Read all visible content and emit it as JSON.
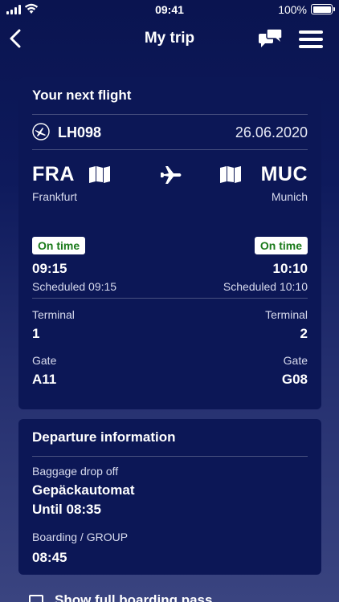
{
  "status_bar": {
    "time": "09:41",
    "battery": "100%"
  },
  "nav": {
    "title": "My trip"
  },
  "next_flight": {
    "title": "Your next flight",
    "flight_number": "LH098",
    "date": "26.06.2020",
    "origin": {
      "code": "FRA",
      "city": "Frankfurt",
      "status": "On time",
      "time": "09:15",
      "scheduled": "Scheduled 09:15",
      "terminal_label": "Terminal",
      "terminal": "1",
      "gate_label": "Gate",
      "gate": "A11"
    },
    "destination": {
      "code": "MUC",
      "city": "Munich",
      "status": "On time",
      "time": "10:10",
      "scheduled": "Scheduled 10:10",
      "terminal_label": "Terminal",
      "terminal": "2",
      "gate_label": "Gate",
      "gate": "G08"
    }
  },
  "departure": {
    "title": "Departure information",
    "baggage_label": "Baggage drop off",
    "baggage_location": "Gepäckautomat",
    "baggage_until": "Until 08:35",
    "boarding_label": "Boarding / GROUP",
    "boarding_time": "08:45"
  },
  "bottom": {
    "label": "Show full boarding pass"
  },
  "colors": {
    "background": "#0e1a5c",
    "card": "#0c1756",
    "on_time": "#1a7a1a"
  },
  "icons": [
    "back-arrow-icon",
    "chat-icon",
    "menu-icon",
    "airline-crane-icon",
    "map-icon",
    "airplane-icon",
    "boarding-pass-icon"
  ]
}
